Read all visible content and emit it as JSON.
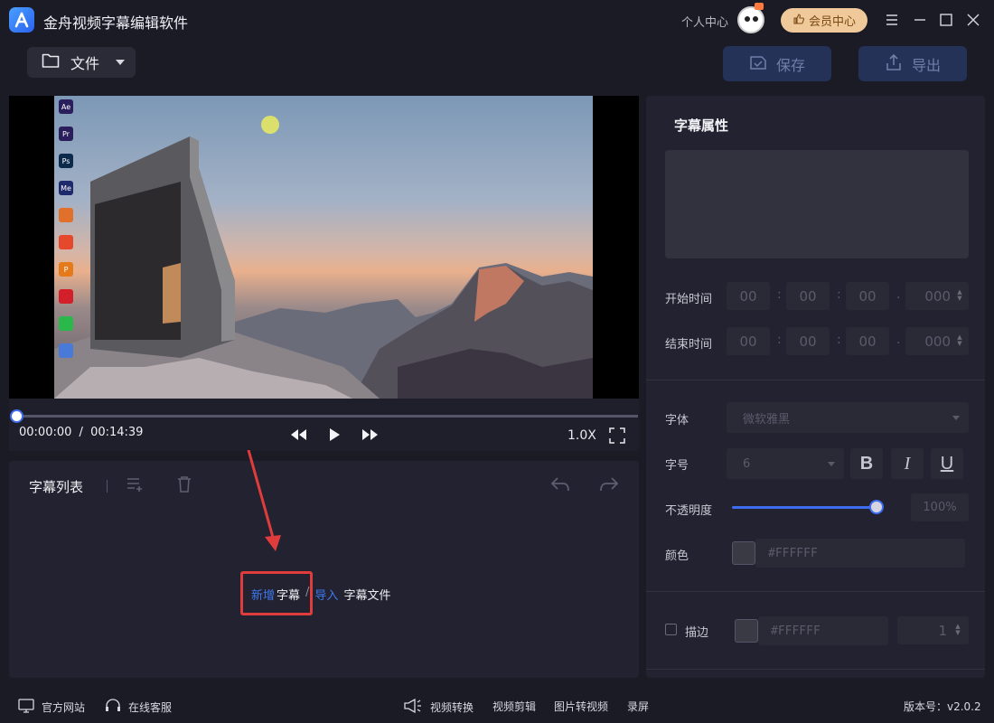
{
  "titlebar": {
    "app_title": "金舟视频字幕编辑软件",
    "personal_center": "个人中心",
    "vip_label": "会员中心"
  },
  "toolbar": {
    "file_label": "文件",
    "save_label": "保存",
    "export_label": "导出"
  },
  "desktop_icons": [
    {
      "label": "Ae",
      "color": "#2a1f5c"
    },
    {
      "label": "Pr",
      "color": "#2a1f5c"
    },
    {
      "label": "Ps",
      "color": "#0c2b4c"
    },
    {
      "label": "Me",
      "color": "#1f2a6c"
    },
    {
      "label": "",
      "color": "#e0702a"
    },
    {
      "label": "",
      "color": "#e5482a"
    },
    {
      "label": "P",
      "color": "#e57a1a"
    },
    {
      "label": "",
      "color": "#d21f2a"
    },
    {
      "label": "",
      "color": "#2ab84a"
    },
    {
      "label": "",
      "color": "#4a7ad8"
    }
  ],
  "player": {
    "current_time": "00:00:00",
    "separator": "/",
    "total_time": "00:14:39",
    "speed": "1.0X",
    "progress_fraction": 0.0
  },
  "subtitle_list": {
    "title": "字幕列表",
    "empty_hint": {
      "add": "新增",
      "subtitle": "字幕",
      "slash": "/",
      "import": "导入",
      "subtitle_file": "字幕文件"
    }
  },
  "properties": {
    "title": "字幕属性",
    "start_time_label": "开始时间",
    "end_time_label": "结束时间",
    "start_time": {
      "h": "00",
      "m": "00",
      "s": "00",
      "ms": "000"
    },
    "end_time": {
      "h": "00",
      "m": "00",
      "s": "00",
      "ms": "000"
    },
    "font_label": "字体",
    "font_value": "微软雅黑",
    "size_label": "字号",
    "size_value": "6",
    "bold": "B",
    "italic": "I",
    "underline": "U",
    "opacity_label": "不透明度",
    "opacity_value": "100%",
    "opacity_fraction": 1.0,
    "color_label": "颜色",
    "color_value": "#FFFFFF",
    "stroke_label": "描边",
    "stroke_color_value": "#FFFFFF",
    "stroke_width": "1"
  },
  "footer": {
    "website": "官方网站",
    "support": "在线客服",
    "convert": "视频转换",
    "edit": "视频剪辑",
    "pic_to_video": "图片转视频",
    "record": "录屏",
    "version": "版本号：v2.0.2"
  },
  "colors": {
    "accent": "#3e6df0",
    "highlight": "#e13c3c",
    "vip": "#f0c99a"
  }
}
